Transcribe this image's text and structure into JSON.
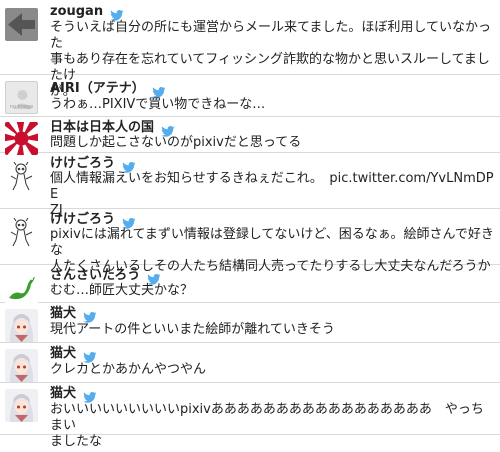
{
  "colors": {
    "bird": "#55acee",
    "divider": "#d9d9d9",
    "flag_red": "#c8102e"
  },
  "icons": {
    "verified": "twitter-bird-icon"
  },
  "tweets": [
    {
      "avatar": "gray-back-arrow-avatar",
      "name": "zougan",
      "lines": [
        "そういえば自分の所にも運営からメール来てました。ほぼ利用していなかった",
        "事もあり存在を忘れていてフィッシング詐欺的な物かと思いスルーしてましたけ",
        "が。"
      ]
    },
    {
      "avatar": "no-image-avatar",
      "avatar_text": "no image",
      "name": "AIRI（アテナ）",
      "lines": [
        "うわぁ…PIXIVで買い物できねーな…"
      ]
    },
    {
      "avatar": "rising-sun-flag-avatar",
      "name": "日本は日本人の国",
      "lines": [
        "問題しか起こさないのがpixivだと思ってる"
      ]
    },
    {
      "avatar": "sketch-character-avatar",
      "name": "けけごろう",
      "lines": [
        "個人情報漏えいをお知らせするきねぇだこれ。　pic.twitter.com/YvLNmDPE",
        "ZJ"
      ]
    },
    {
      "avatar": "sketch-character-avatar",
      "name": "けけごろう",
      "lines": [
        "pixivには漏れてまずい情報は登録してないけど、困るなぁ。絵師さんで好きな",
        "人たくさんいるしその人たち結構同人売ってたりするし大丈夫なんだろうか"
      ]
    },
    {
      "avatar": "green-lizard-avatar",
      "name": "さんさいたろう",
      "lines": [
        "むむ…師匠大丈夫かな？"
      ]
    },
    {
      "avatar": "white-hair-girl-avatar",
      "name": "猫犬",
      "lines": [
        "現代アートの件といいまた絵師が離れていきそう"
      ]
    },
    {
      "avatar": "white-hair-girl-avatar",
      "name": "猫犬",
      "lines": [
        "クレカとかあかんやつやん"
      ]
    },
    {
      "avatar": "white-hair-girl-avatar",
      "name": "猫犬",
      "lines": [
        "おいいいいいいいいいpixivあああああああああああああああああ　やっちまい",
        "ましたな"
      ]
    }
  ]
}
